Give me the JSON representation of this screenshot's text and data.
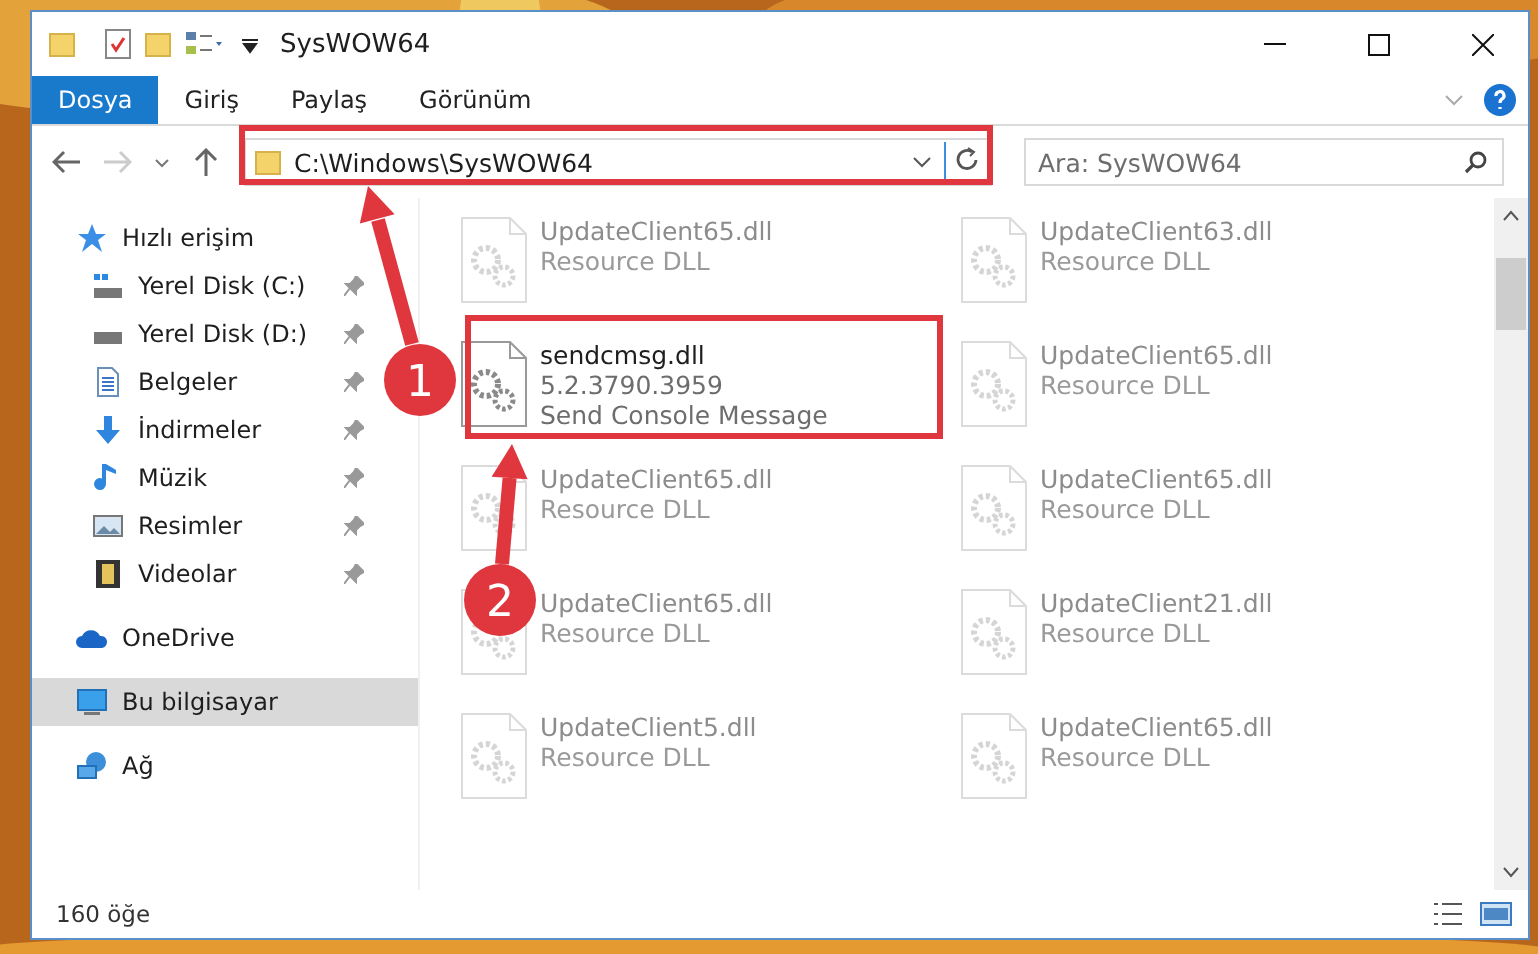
{
  "window": {
    "title": "SysWOW64"
  },
  "ribbon_tabs": [
    {
      "label": "Dosya",
      "selected": true
    },
    {
      "label": "Giriş",
      "selected": false
    },
    {
      "label": "Paylaş",
      "selected": false
    },
    {
      "label": "Görünüm",
      "selected": false
    }
  ],
  "address": {
    "path": "C:\\Windows\\SysWOW64"
  },
  "search": {
    "placeholder": "Ara: SysWOW64"
  },
  "sidebar": {
    "items": [
      {
        "label": "Hızlı erişim",
        "selected": false,
        "children": [
          {
            "label": "Yerel Disk (C:)",
            "selected": false,
            "pinned": true
          },
          {
            "label": "Yerel Disk (D:)",
            "selected": false,
            "pinned": true
          },
          {
            "label": "Belgeler",
            "selected": false,
            "pinned": true
          },
          {
            "label": "İndirmeler",
            "selected": false,
            "pinned": true
          },
          {
            "label": "Müzik",
            "selected": false,
            "pinned": true
          },
          {
            "label": "Resimler",
            "selected": false,
            "pinned": true
          },
          {
            "label": "Videolar",
            "selected": false,
            "pinned": true
          }
        ]
      },
      {
        "label": "OneDrive",
        "selected": false
      },
      {
        "label": "Bu bilgisayar",
        "selected": true
      },
      {
        "label": "Ağ",
        "selected": false
      }
    ]
  },
  "files": [
    {
      "name": "UpdateClient65.dll",
      "lines": [
        "Resource DLL"
      ],
      "faded": true
    },
    {
      "name": "UpdateClient63.dll",
      "lines": [
        "Resource DLL"
      ],
      "faded": true
    },
    {
      "name": "sendcmsg.dll",
      "lines": [
        "5.2.3790.3959",
        "Send Console Message"
      ],
      "faded": false
    },
    {
      "name": "UpdateClient65.dll",
      "lines": [
        "Resource DLL"
      ],
      "faded": true
    },
    {
      "name": "UpdateClient65.dll",
      "lines": [
        "Resource DLL"
      ],
      "faded": true
    },
    {
      "name": "UpdateClient65.dll",
      "lines": [
        "Resource DLL"
      ],
      "faded": true
    },
    {
      "name": "UpdateClient65.dll",
      "lines": [
        "Resource DLL"
      ],
      "faded": true
    },
    {
      "name": "UpdateClient21.dll",
      "lines": [
        "Resource DLL"
      ],
      "faded": true
    },
    {
      "name": "UpdateClient5.dll",
      "lines": [
        "Resource DLL"
      ],
      "faded": true
    },
    {
      "name": "UpdateClient65.dll",
      "lines": [
        "Resource DLL"
      ],
      "faded": true
    }
  ],
  "status_bar": {
    "count": "160 öğe"
  },
  "callouts": [
    {
      "label": "1"
    },
    {
      "label": "2"
    }
  ]
}
